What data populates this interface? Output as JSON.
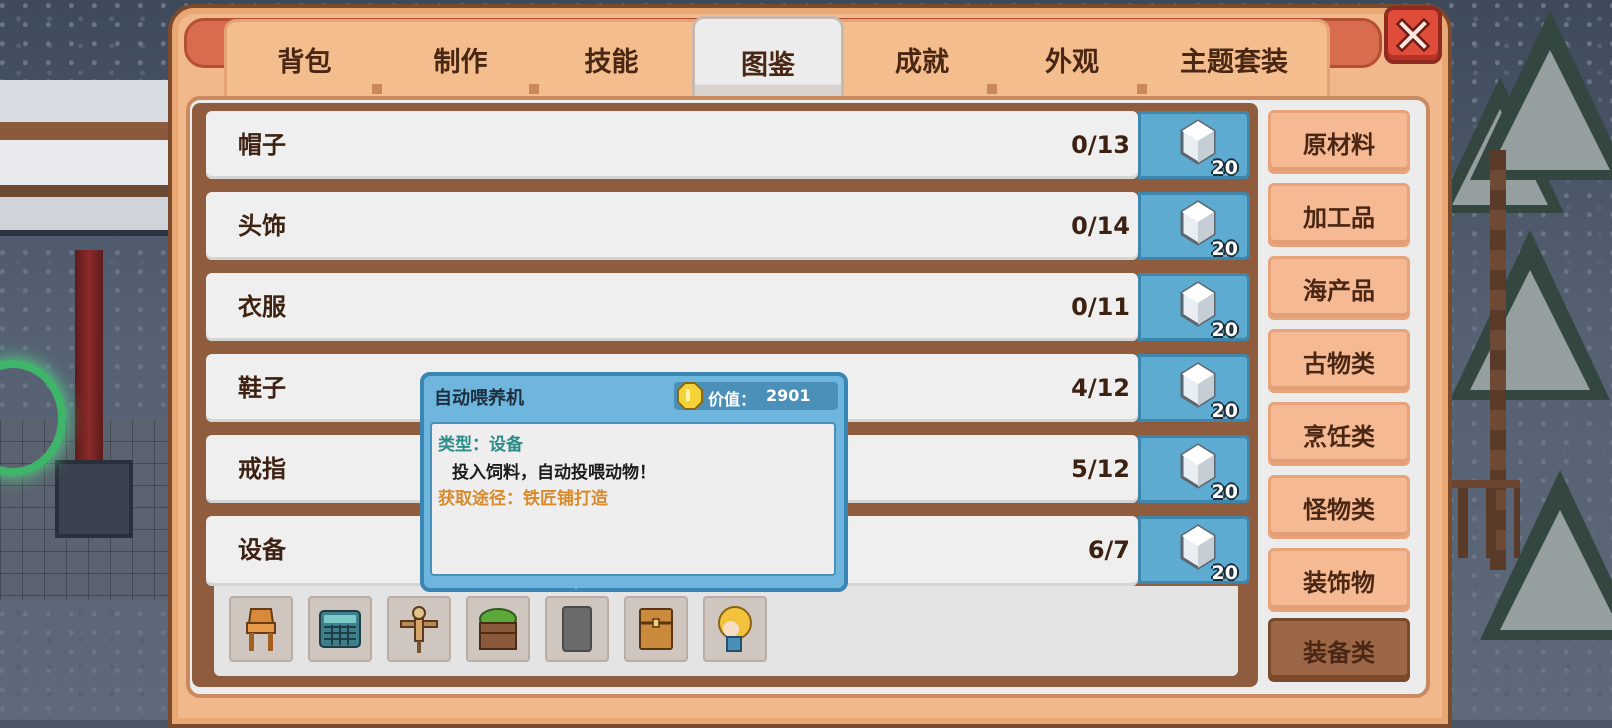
{
  "tabs": [
    {
      "label": "背包"
    },
    {
      "label": "制作"
    },
    {
      "label": "技能"
    },
    {
      "label": "图鉴",
      "active": true
    },
    {
      "label": "成就"
    },
    {
      "label": "外观"
    },
    {
      "label": "主题套装"
    }
  ],
  "close_icon": "close-x-icon",
  "collection_rows": [
    {
      "name": "帽子",
      "progress": "0/13",
      "reward_count": "20",
      "reward_icon": "silver-gem-icon"
    },
    {
      "name": "头饰",
      "progress": "0/14",
      "reward_count": "20",
      "reward_icon": "silver-gem-icon"
    },
    {
      "name": "衣服",
      "progress": "0/11",
      "reward_count": "20",
      "reward_icon": "silver-gem-icon"
    },
    {
      "name": "鞋子",
      "progress": "4/12",
      "reward_count": "20",
      "reward_icon": "silver-gem-icon"
    },
    {
      "name": "戒指",
      "progress": "5/12",
      "reward_count": "20",
      "reward_icon": "silver-gem-icon"
    },
    {
      "name": "设备",
      "progress": "6/7",
      "reward_count": "20",
      "reward_icon": "silver-gem-icon"
    }
  ],
  "expanded_items": [
    {
      "icon": "wooden-chair-icon"
    },
    {
      "icon": "automatic-feeder-icon"
    },
    {
      "icon": "scarecrow-icon"
    },
    {
      "icon": "planter-box-icon"
    },
    {
      "icon": "locked-slot-icon"
    },
    {
      "icon": "wooden-chest-icon"
    },
    {
      "icon": "blonde-character-icon"
    }
  ],
  "categories": [
    {
      "label": "原材料"
    },
    {
      "label": "加工品"
    },
    {
      "label": "海产品"
    },
    {
      "label": "古物类"
    },
    {
      "label": "烹饪类"
    },
    {
      "label": "怪物类"
    },
    {
      "label": "装饰物"
    },
    {
      "label": "装备类",
      "active": true
    }
  ],
  "tooltip": {
    "title": "自动喂养机",
    "value_label": "价值：",
    "value": "2901",
    "value_icon": "gold-coin-icon",
    "type_line": "类型：设备",
    "description": "投入饲料，自动投喂动物！",
    "source_line": "获取途径：铁匠铺打造"
  },
  "colors": {
    "panel": "#f1b98b",
    "reward_bg": "#5eabd1",
    "active_category": "#9b6747",
    "tooltip_type": "#2c8c88",
    "tooltip_source": "#d98a2b"
  }
}
